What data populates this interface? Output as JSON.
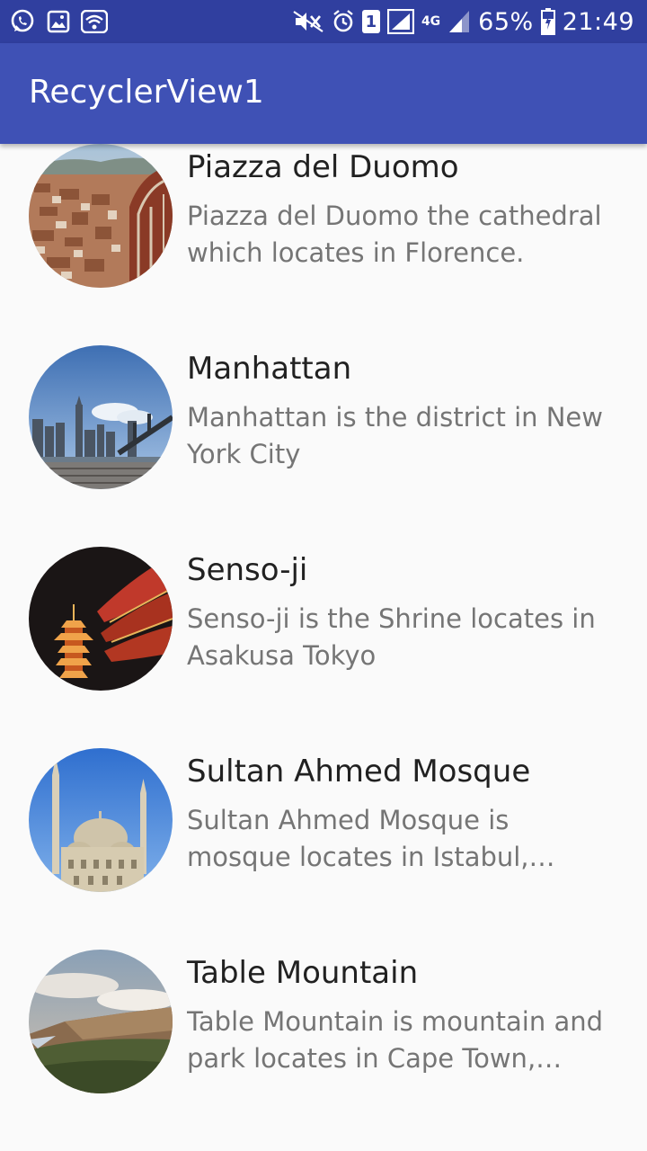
{
  "status_bar": {
    "battery_percent": "65%",
    "time": "21:49",
    "sim_slot": "1",
    "network_type": "4G",
    "left_icons": [
      "whatsapp-icon",
      "gallery-icon",
      "wifi-icon"
    ],
    "right_icons": [
      "mute-icon",
      "alarm-icon",
      "sim-icon",
      "signal-icon",
      "signal-icon",
      "battery-icon"
    ]
  },
  "app_bar": {
    "title": "RecyclerView1",
    "color": "#3f51b5",
    "status_color": "#303f9f"
  },
  "items": [
    {
      "title": "Piazza del Duomo",
      "description": "Piazza del Duomo the cathedral which locates in Florence."
    },
    {
      "title": "Manhattan",
      "description": "Manhattan is the district in New York City"
    },
    {
      "title": "Senso-ji",
      "description": "Senso-ji is the Shrine locates in Asakusa Tokyo"
    },
    {
      "title": "Sultan Ahmed Mosque",
      "description": "Sultan Ahmed Mosque is mosque locates in Istabul, Turkey"
    },
    {
      "title": "Table Mountain",
      "description": "Table Mountain is mountain and park locates in Cape Town, South Africa"
    }
  ]
}
